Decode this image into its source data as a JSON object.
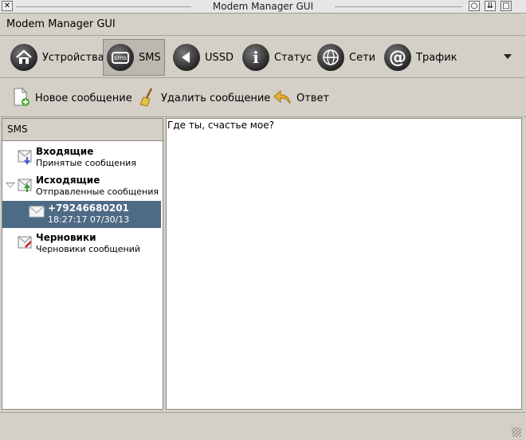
{
  "window": {
    "title": "Modem Manager GUI",
    "close_glyph": "✕",
    "minimize_glyph": "○",
    "shade_glyph": "⇊",
    "maximize_glyph": "□"
  },
  "app": {
    "header_title": "Modem Manager GUI"
  },
  "main_tabs": [
    {
      "label": "Устройства",
      "icon": "devices-icon",
      "active": false
    },
    {
      "label": "SMS",
      "icon": "sms-icon",
      "icon_text": "sms",
      "active": true
    },
    {
      "label": "USSD",
      "icon": "ussd-icon",
      "active": false
    },
    {
      "label": "Статус",
      "icon": "info-icon",
      "icon_text": "i",
      "active": false
    },
    {
      "label": "Сети",
      "icon": "network-icon",
      "active": false
    },
    {
      "label": "Трафик",
      "icon": "traffic-icon",
      "icon_text": "@",
      "active": false
    }
  ],
  "actions": {
    "new_message": "Новое сообщение",
    "delete_message": "Удалить сообщение",
    "reply": "Ответ"
  },
  "sms_tree": {
    "header": "SMS",
    "items": [
      {
        "title": "Входящие",
        "subtitle": "Принятые сообщения",
        "icon": "inbox-icon"
      },
      {
        "title": "Исходящие",
        "subtitle": "Отправленные сообщения",
        "icon": "outbox-icon",
        "expanded": true
      },
      {
        "title": "+79246680201",
        "subtitle": "18:27:17 07/30/13",
        "icon": "message-icon",
        "selected": true,
        "child": true
      },
      {
        "title": "Черновики",
        "subtitle": "Черновики сообщений",
        "icon": "drafts-icon"
      }
    ]
  },
  "message_view": {
    "text": "Где ты, счастье мое?"
  },
  "colors": {
    "selection": "#4d6b84",
    "window_bg": "#d4d0c8",
    "inbox_arrow": "#3a5fcd",
    "outbox_arrow": "#2e9b2e",
    "drafts_arrow": "#d42020"
  }
}
